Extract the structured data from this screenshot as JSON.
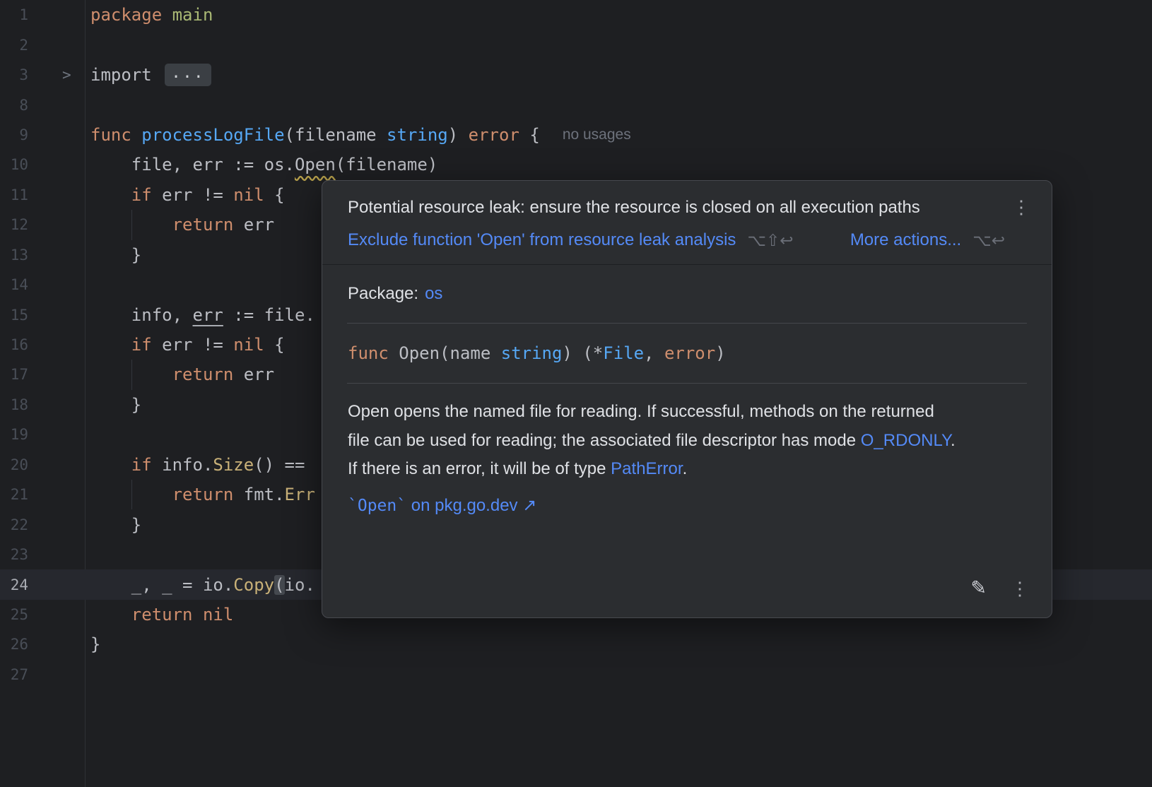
{
  "icons": {
    "kebab": "⋮",
    "pencil": "✎",
    "fold_chevron": ">"
  },
  "editor": {
    "lines": [
      {
        "num": "1",
        "tokens": [
          [
            "kw",
            "package"
          ],
          [
            "pl",
            " "
          ],
          [
            "grn",
            "main"
          ]
        ]
      },
      {
        "num": "2",
        "tokens": []
      },
      {
        "num": "3",
        "fold": true,
        "tokens": [
          [
            "pl",
            "import "
          ],
          [
            "fold",
            "..."
          ]
        ]
      },
      {
        "num": "8",
        "tokens": []
      },
      {
        "num": "9",
        "tokens": [
          [
            "kw",
            "func"
          ],
          [
            "pl",
            " "
          ],
          [
            "fn",
            "processLogFile"
          ],
          [
            "pl",
            "(filename "
          ],
          [
            "typ",
            "string"
          ],
          [
            "pl",
            ") "
          ],
          [
            "kw",
            "error"
          ],
          [
            "pl",
            " {"
          ]
        ],
        "hint": "no usages"
      },
      {
        "num": "10",
        "tokens": [
          [
            "pl",
            "    file, err := os."
          ],
          [
            "wavy",
            "Open"
          ],
          [
            "pl",
            "(filename)"
          ]
        ]
      },
      {
        "num": "11",
        "tokens": [
          [
            "pl",
            "    "
          ],
          [
            "kw",
            "if"
          ],
          [
            "pl",
            " err != "
          ],
          [
            "kw",
            "nil"
          ],
          [
            "pl",
            " {"
          ]
        ]
      },
      {
        "num": "12",
        "guide": true,
        "tokens": [
          [
            "pl",
            "        "
          ],
          [
            "kw",
            "return"
          ],
          [
            "pl",
            " err"
          ]
        ]
      },
      {
        "num": "13",
        "tokens": [
          [
            "pl",
            "    }"
          ]
        ]
      },
      {
        "num": "14",
        "tokens": []
      },
      {
        "num": "15",
        "tokens": [
          [
            "pl",
            "    info, "
          ],
          [
            "ul",
            "err"
          ],
          [
            "pl",
            " := file."
          ]
        ]
      },
      {
        "num": "16",
        "tokens": [
          [
            "pl",
            "    "
          ],
          [
            "kw",
            "if"
          ],
          [
            "pl",
            " err != "
          ],
          [
            "kw",
            "nil"
          ],
          [
            "pl",
            " {"
          ]
        ]
      },
      {
        "num": "17",
        "guide": true,
        "tokens": [
          [
            "pl",
            "        "
          ],
          [
            "kw",
            "return"
          ],
          [
            "pl",
            " err"
          ]
        ]
      },
      {
        "num": "18",
        "tokens": [
          [
            "pl",
            "    }"
          ]
        ]
      },
      {
        "num": "19",
        "tokens": []
      },
      {
        "num": "20",
        "tokens": [
          [
            "pl",
            "    "
          ],
          [
            "kw",
            "if"
          ],
          [
            "pl",
            " info."
          ],
          [
            "call",
            "Size"
          ],
          [
            "pl",
            "() =="
          ]
        ]
      },
      {
        "num": "21",
        "guide": true,
        "tokens": [
          [
            "pl",
            "        "
          ],
          [
            "kw",
            "return"
          ],
          [
            "pl",
            " fmt."
          ],
          [
            "call",
            "Err"
          ]
        ]
      },
      {
        "num": "22",
        "tokens": [
          [
            "pl",
            "    }"
          ]
        ]
      },
      {
        "num": "23",
        "tokens": []
      },
      {
        "num": "24",
        "current": true,
        "tokens": [
          [
            "pl",
            "    _, _ = io."
          ],
          [
            "call",
            "Copy"
          ],
          [
            "brkt",
            "("
          ],
          [
            "pl",
            "io."
          ]
        ]
      },
      {
        "num": "25",
        "tokens": [
          [
            "pl",
            "    "
          ],
          [
            "kw",
            "return"
          ],
          [
            "pl",
            " "
          ],
          [
            "kw",
            "nil"
          ]
        ]
      },
      {
        "num": "26",
        "tokens": [
          [
            "pl",
            "}"
          ]
        ]
      },
      {
        "num": "27",
        "tokens": []
      }
    ]
  },
  "popup": {
    "warning": {
      "title": "Potential resource leak: ensure the resource is closed on all execution paths",
      "action_label": "Exclude function 'Open' from resource leak analysis",
      "action_shortcut": "⌥⇧↩",
      "more_actions_label": "More actions...",
      "more_actions_shortcut": "⌥↩"
    },
    "package_label": "Package:",
    "package_name": "os",
    "signature": [
      [
        "kw",
        "func"
      ],
      [
        "pl",
        " Open(name "
      ],
      [
        "typ",
        "string"
      ],
      [
        "pl",
        ") (*"
      ],
      [
        "typ",
        "File"
      ],
      [
        "pl",
        ", "
      ],
      [
        "kw",
        "error"
      ],
      [
        "pl",
        ")"
      ]
    ],
    "description_lines": [
      [
        [
          "t",
          "Open opens the named file for reading. If successful, methods on the returned"
        ]
      ],
      [
        [
          "t",
          "file can be used for reading; the associated file descriptor has mode "
        ],
        [
          "a",
          "O_RDONLY"
        ],
        [
          "t",
          "."
        ]
      ],
      [
        [
          "t",
          "If there is an error, it will be of type "
        ],
        [
          "a",
          "PathError"
        ],
        [
          "t",
          "."
        ]
      ]
    ],
    "doc_link_code": "`Open`",
    "doc_link_rest": " on pkg.go.dev ↗"
  }
}
